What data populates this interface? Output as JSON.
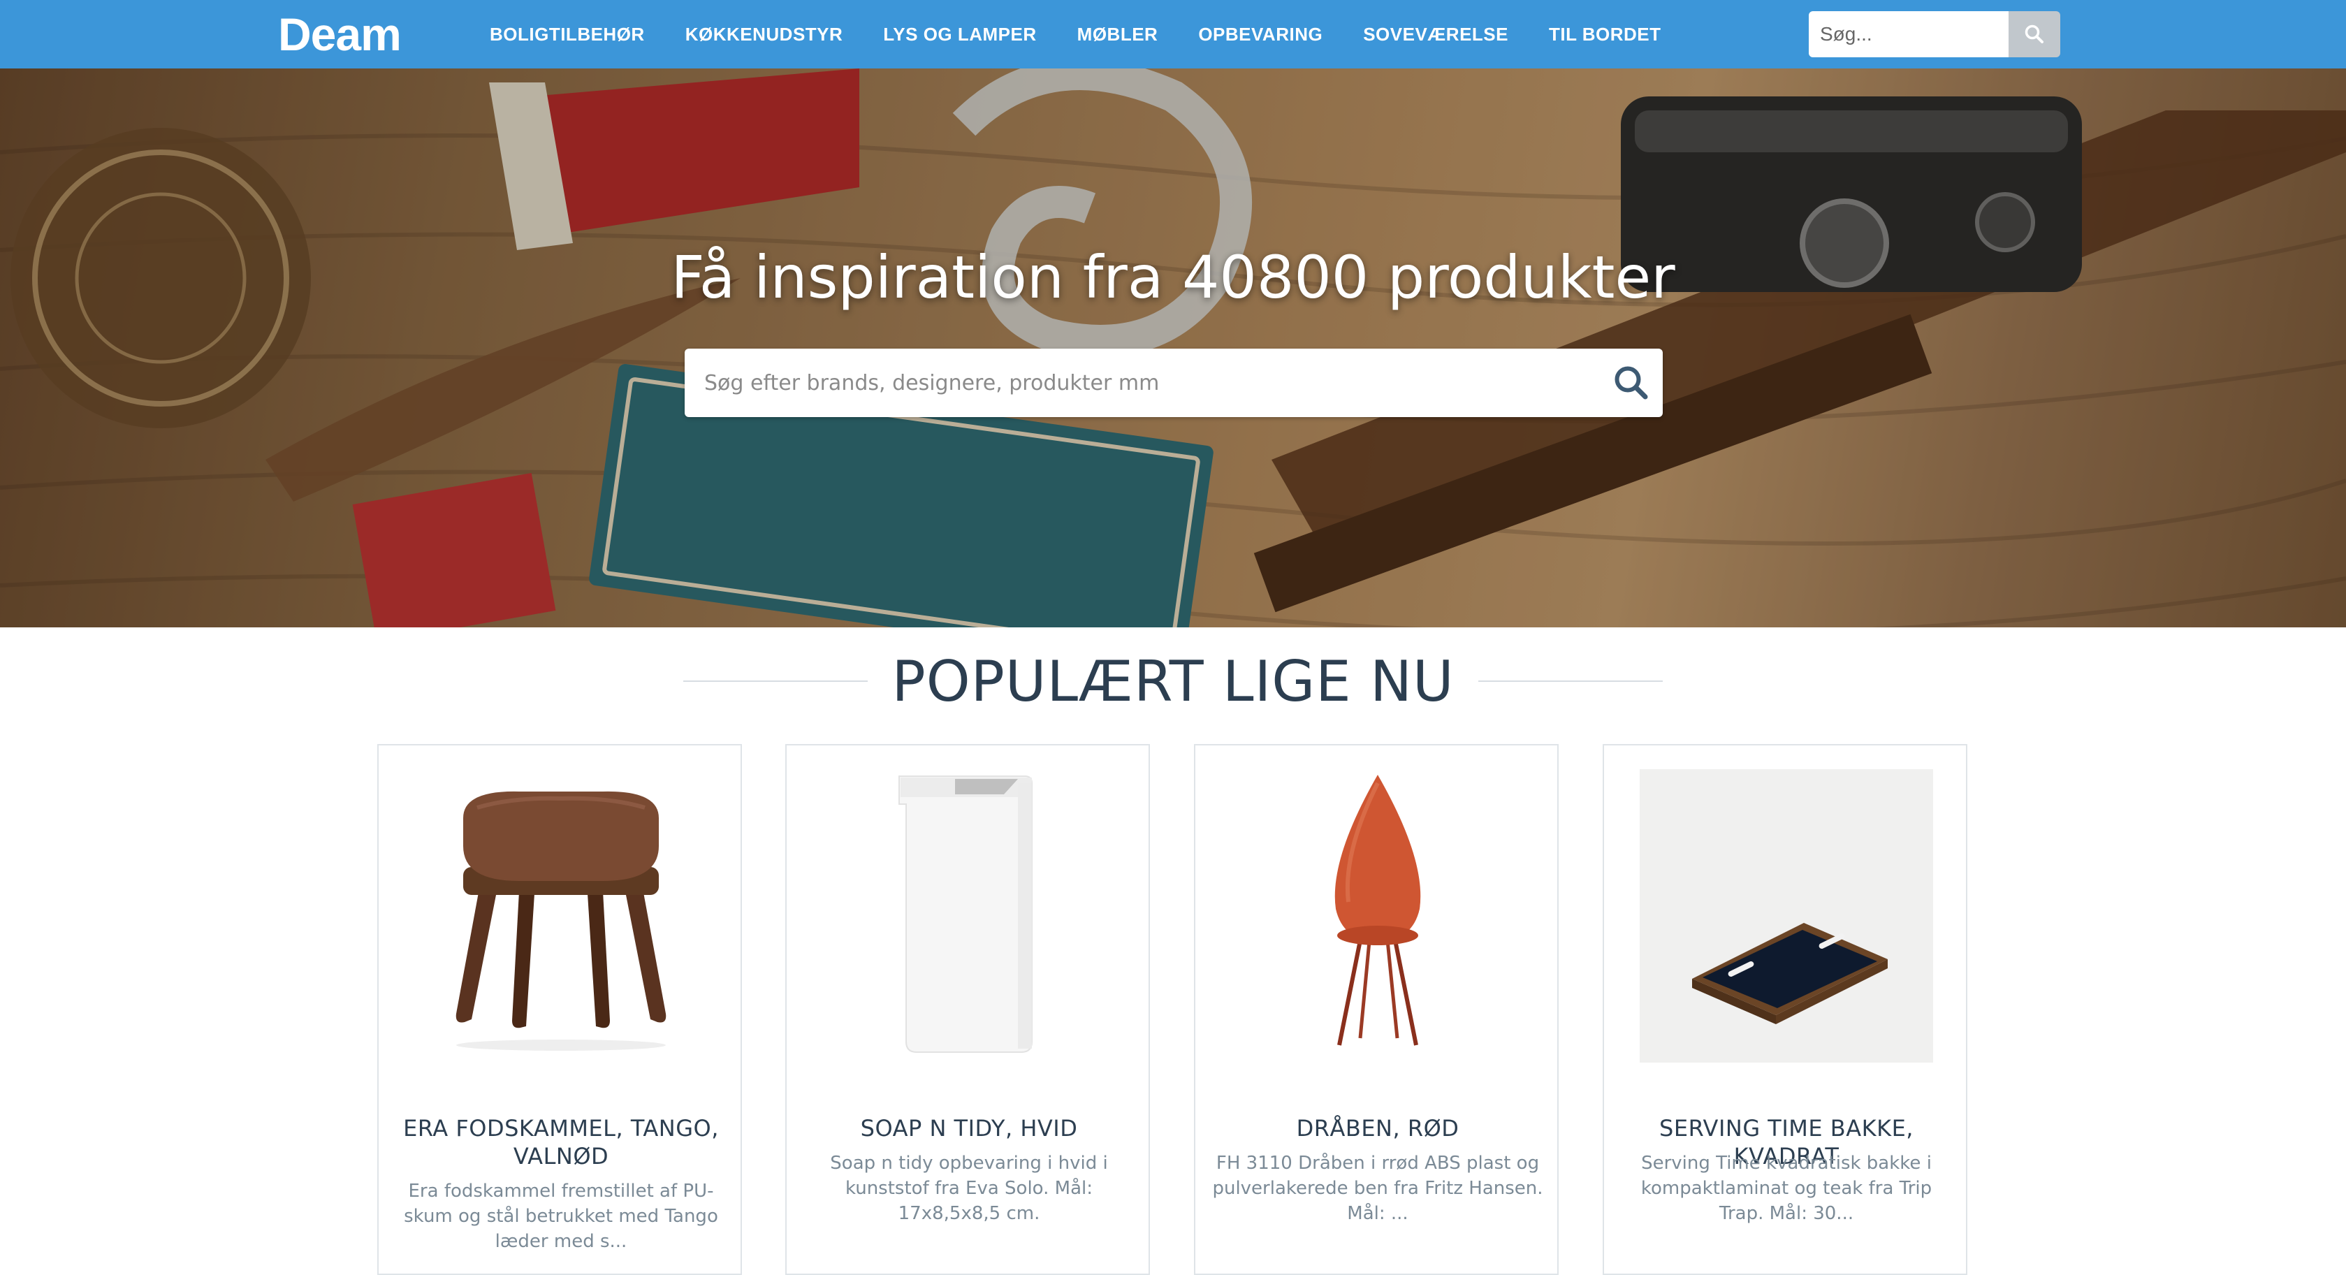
{
  "header": {
    "logo": "Deam",
    "nav_items": [
      "BOLIGTILBEHØR",
      "KØKKENUDSTYR",
      "LYS OG LAMPER",
      "MØBLER",
      "OPBEVARING",
      "SOVEVÆRELSE",
      "TIL BORDET"
    ],
    "search_placeholder": "Søg...",
    "search_icon": "search-icon",
    "brand_color": "#3c96d9"
  },
  "hero": {
    "title": "Få inspiration fra 40800 produkter",
    "search_placeholder": "Søg efter brands, designere, produkter mm",
    "search_icon": "search-icon"
  },
  "section": {
    "heading": "POPULÆRT LIGE NU"
  },
  "products": [
    {
      "title": "ERA FODSKAMMEL, TANGO, VALNØD",
      "description": "Era fodskammel fremstillet af PU-skum og stål betrukket med Tango læder med s...",
      "image": "footstool"
    },
    {
      "title": "SOAP N TIDY, HVID",
      "description": "Soap n tidy opbevaring i hvid i kunststof fra Eva Solo. Mål: 17x8,5x8,5 cm.",
      "image": "soap-holder"
    },
    {
      "title": "DRÅBEN, RØD",
      "description": "FH 3110 Dråben i rrød ABS plast og pulverlakerede ben fra Fritz Hansen. Mål: ...",
      "image": "drop-chair"
    },
    {
      "title": "SERVING TIME BAKKE, KVADRAT",
      "description": "Serving Time kvadratisk bakke i kompaktlaminat og teak fra Trip Trap. Mål: 30...",
      "image": "serving-tray"
    }
  ]
}
